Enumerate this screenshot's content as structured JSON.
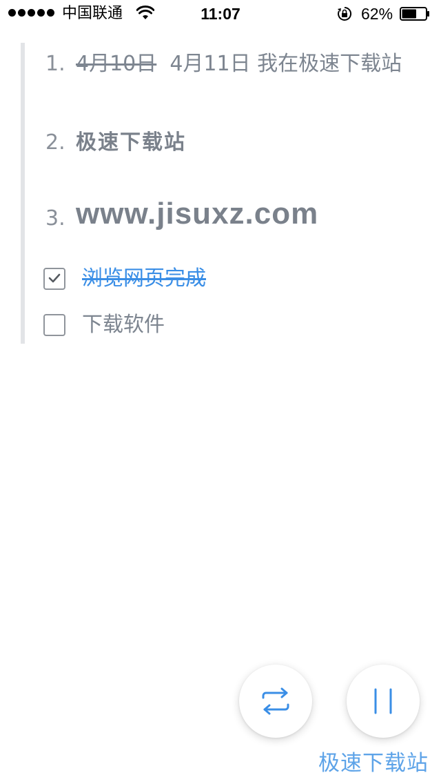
{
  "status_bar": {
    "carrier": "中国联通",
    "time": "11:07",
    "battery_percent": "62%",
    "battery_level": 0.62,
    "signal_bars": 5,
    "icons": [
      "wifi-icon",
      "rotation-lock-icon",
      "battery-icon"
    ]
  },
  "note": {
    "ordered_list": [
      {
        "number": "1.",
        "struck_text": "4月10日",
        "text": "4月11日 我在极速下载站"
      },
      {
        "number": "2.",
        "text": "极速下载站"
      },
      {
        "number": "3.",
        "text": "www.jisuxz.com"
      }
    ],
    "todos": [
      {
        "label": "浏览网页完成",
        "checked": true
      },
      {
        "label": "下载软件",
        "checked": false
      }
    ]
  },
  "actions": {
    "switch_icon": "swap-arrows-icon",
    "pause_icon": "pause-icon"
  },
  "colors": {
    "accent": "#3a8ee6",
    "text": "#7d8590",
    "quote_bar": "#e2e4e7"
  },
  "watermark": "极速下载站"
}
